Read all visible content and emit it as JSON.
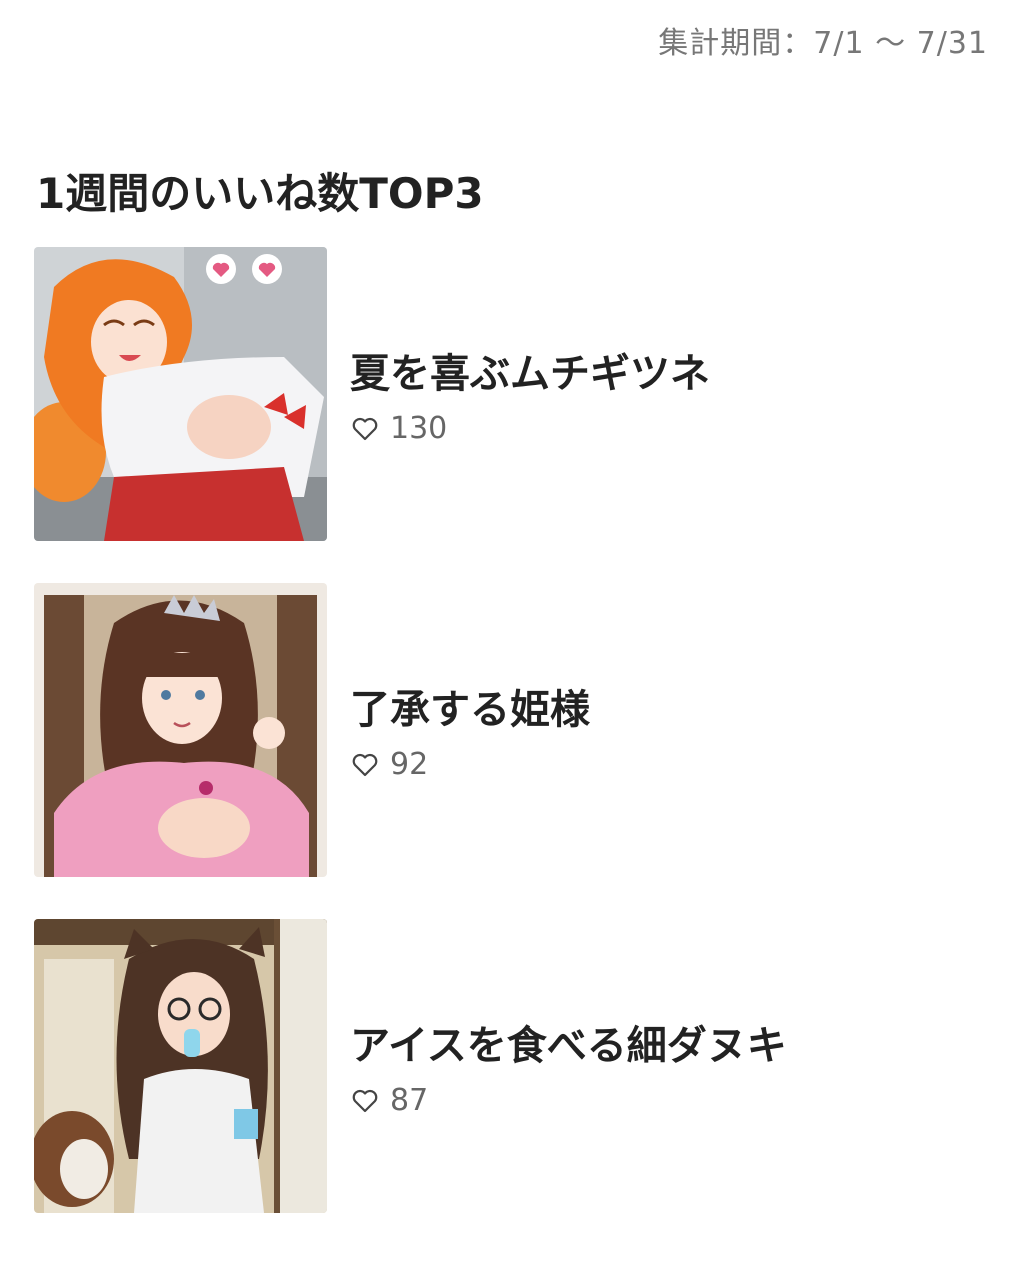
{
  "header": {
    "period_label": "集計期間：7/1 〜 7/31"
  },
  "section": {
    "title": "1週間のいいね数TOP3"
  },
  "ranking": [
    {
      "title": "夏を喜ぶムチギツネ",
      "likes": "130",
      "thumbnail_icon": "fox-girl-illustration"
    },
    {
      "title": "了承する姫様",
      "likes": "92",
      "thumbnail_icon": "princess-illustration"
    },
    {
      "title": "アイスを食べる細ダヌキ",
      "likes": "87",
      "thumbnail_icon": "tanuki-girl-illustration"
    }
  ],
  "colors": {
    "text": "#222222",
    "muted": "#777777",
    "likes": "#666666"
  }
}
